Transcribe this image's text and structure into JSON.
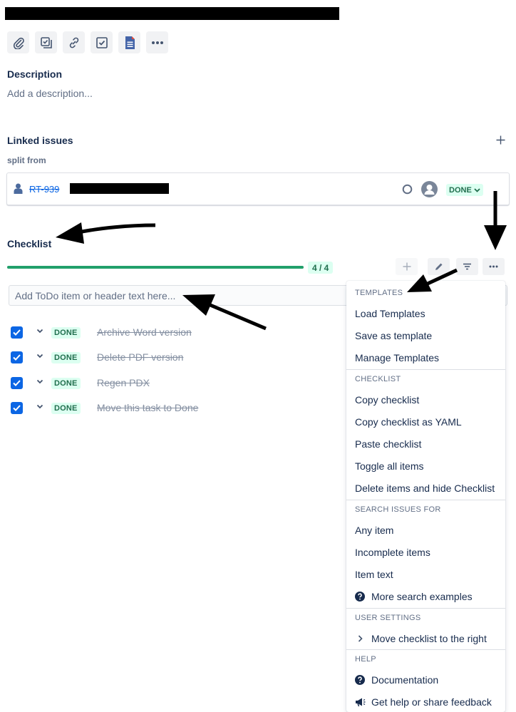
{
  "toolbar": {
    "buttons": [
      "attachment-icon",
      "child-issues-icon",
      "link-icon",
      "checklist-icon",
      "document-icon",
      "more-icon"
    ]
  },
  "description": {
    "title": "Description",
    "placeholder": "Add a description..."
  },
  "linked_issues": {
    "title": "Linked issues",
    "relation": "split from",
    "issue_key": "RT-939",
    "status": "DONE"
  },
  "checklist": {
    "title": "Checklist",
    "progress_label": "4 / 4",
    "progress_fraction": 1.0,
    "input_placeholder": "Add ToDo item or header text here...",
    "items": [
      {
        "status": "DONE",
        "text": "Archive Word version"
      },
      {
        "status": "DONE",
        "text": "Delete PDF version"
      },
      {
        "status": "DONE",
        "text": "Regen PDX"
      },
      {
        "status": "DONE",
        "text": "Move this task to Done"
      }
    ]
  },
  "menu": {
    "templates": {
      "heading": "TEMPLATES",
      "items": [
        "Load Templates",
        "Save as template",
        "Manage Templates"
      ]
    },
    "checklist": {
      "heading": "CHECKLIST",
      "items": [
        "Copy checklist",
        "Copy checklist as YAML",
        "Paste checklist",
        "Toggle all items",
        "Delete items and hide Checklist"
      ]
    },
    "search": {
      "heading": "SEARCH ISSUES FOR",
      "items": [
        "Any item",
        "Incomplete items",
        "Item text",
        "More search examples"
      ]
    },
    "user_settings": {
      "heading": "USER SETTINGS",
      "items": [
        "Move checklist to the right"
      ]
    },
    "help": {
      "heading": "HELP",
      "items": [
        "Documentation",
        "Get help or share feedback"
      ]
    }
  },
  "colors": {
    "accent_blue": "#0c66e4",
    "progress_green": "#22a06b",
    "done_text": "#216e4e",
    "done_bg": "#dcfff1"
  }
}
